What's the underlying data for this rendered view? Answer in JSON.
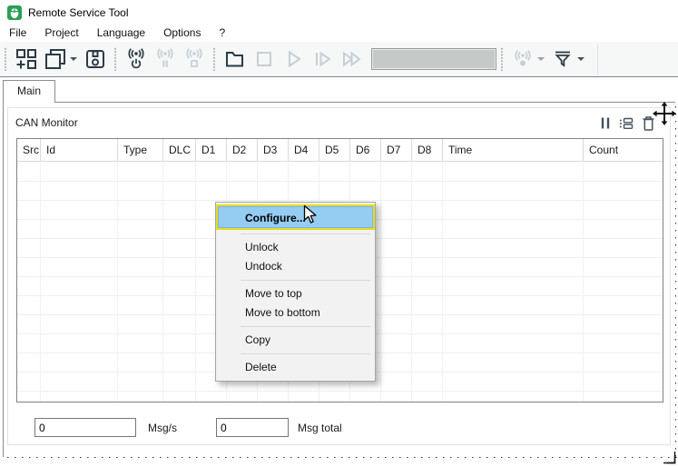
{
  "window": {
    "title": "Remote Service Tool",
    "app_icon": "green-mouse-icon"
  },
  "menubar": {
    "items": [
      "File",
      "Project",
      "Language",
      "Options",
      "?"
    ]
  },
  "toolbar": {
    "groups": [
      {
        "buttons": [
          {
            "name": "add-view",
            "icon": "grid-add-icon",
            "enabled": true
          },
          {
            "name": "windows",
            "icon": "windows-icon",
            "enabled": true,
            "dropdown": true
          },
          {
            "name": "save",
            "icon": "save-icon",
            "enabled": true
          }
        ]
      },
      {
        "buttons": [
          {
            "name": "connect",
            "icon": "antenna-power-icon",
            "enabled": true
          },
          {
            "name": "pause-connection",
            "icon": "antenna-pause-icon",
            "enabled": false
          },
          {
            "name": "stop-connection",
            "icon": "antenna-stop-icon",
            "enabled": false
          }
        ]
      },
      {
        "buttons": [
          {
            "name": "open-log",
            "icon": "folder-icon",
            "enabled": true
          },
          {
            "name": "stop-playback",
            "icon": "stop-icon",
            "enabled": false
          },
          {
            "name": "play",
            "icon": "play-icon",
            "enabled": false
          },
          {
            "name": "step",
            "icon": "step-icon",
            "enabled": false
          },
          {
            "name": "fast-forward",
            "icon": "fast-forward-icon",
            "enabled": false
          }
        ],
        "progress_display": ""
      },
      {
        "buttons": [
          {
            "name": "channel",
            "icon": "antenna-icon",
            "enabled": false,
            "dropdown": true
          },
          {
            "name": "filter",
            "icon": "filter-icon",
            "enabled": true,
            "dropdown": true
          }
        ]
      }
    ]
  },
  "tabs": [
    {
      "label": "Main",
      "active": true
    }
  ],
  "panel": {
    "title": "CAN Monitor",
    "header_icons": [
      "pause-icon",
      "dock-icon",
      "trash-icon"
    ],
    "table": {
      "columns": [
        "Src",
        "Id",
        "Type",
        "DLC",
        "D1",
        "D2",
        "D3",
        "D4",
        "D5",
        "D6",
        "D7",
        "D8",
        "Time",
        "Count"
      ],
      "rows": []
    },
    "footer": {
      "msg_rate_value": "0",
      "msg_rate_label": "Msg/s",
      "msg_total_value": "0",
      "msg_total_label": "Msg total"
    }
  },
  "context_menu": {
    "items": [
      {
        "label": "Configure...",
        "highlighted": true,
        "annotated": true
      },
      {
        "type": "separator"
      },
      {
        "label": "Unlock"
      },
      {
        "label": "Undock"
      },
      {
        "type": "separator"
      },
      {
        "label": "Move to top"
      },
      {
        "label": "Move to bottom"
      },
      {
        "type": "separator"
      },
      {
        "label": "Copy"
      },
      {
        "type": "separator"
      },
      {
        "label": "Delete"
      }
    ]
  },
  "colors": {
    "highlight_blue": "#94ccf2",
    "annotation_yellow": "#e6dc20",
    "icon_dark": "#2d3a47",
    "icon_disabled": "#c6cfd6",
    "app_icon_green": "#2aa052"
  }
}
